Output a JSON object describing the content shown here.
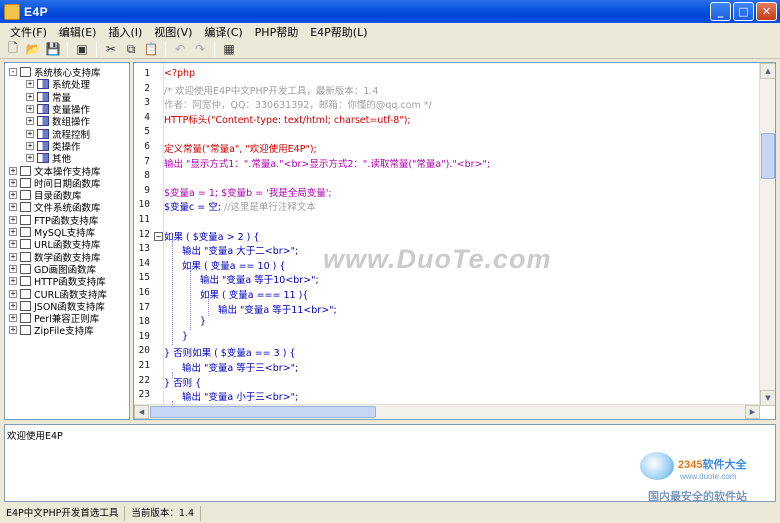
{
  "window": {
    "title": "E4P"
  },
  "menu": [
    "文件(F)",
    "编辑(E)",
    "插入(I)",
    "视图(V)",
    "编译(C)",
    "PHP帮助",
    "E4P帮助(L)"
  ],
  "toolbar": {
    "icons": [
      "new-file-icon",
      "open-folder-icon",
      "save-icon",
      "save-all-icon",
      "cut-icon",
      "copy-icon",
      "paste-icon",
      "undo-icon",
      "redo-icon",
      "compile-icon"
    ]
  },
  "tree": {
    "nodes": [
      {
        "label": "系统核心支持库",
        "level": 0,
        "expander": "-",
        "icon": "library"
      },
      {
        "label": "系统处理",
        "level": 1,
        "expander": "+",
        "icon": "book"
      },
      {
        "label": "常量",
        "level": 1,
        "expander": "+",
        "icon": "book"
      },
      {
        "label": "变量操作",
        "level": 1,
        "expander": "+",
        "icon": "book"
      },
      {
        "label": "数组操作",
        "level": 1,
        "expander": "+",
        "icon": "book"
      },
      {
        "label": "流程控制",
        "level": 1,
        "expander": "+",
        "icon": "book"
      },
      {
        "label": "类操作",
        "level": 1,
        "expander": "+",
        "icon": "book"
      },
      {
        "label": "其他",
        "level": 1,
        "expander": "+",
        "icon": "book"
      },
      {
        "label": "文本操作支持库",
        "level": 0,
        "expander": "+",
        "icon": "library"
      },
      {
        "label": "时间日期函数库",
        "level": 0,
        "expander": "+",
        "icon": "library"
      },
      {
        "label": "目录函数库",
        "level": 0,
        "expander": "+",
        "icon": "library"
      },
      {
        "label": "文件系统函数库",
        "level": 0,
        "expander": "+",
        "icon": "library"
      },
      {
        "label": "FTP函数支持库",
        "level": 0,
        "expander": "+",
        "icon": "library"
      },
      {
        "label": "MySQL支持库",
        "level": 0,
        "expander": "+",
        "icon": "library"
      },
      {
        "label": "URL函数支持库",
        "level": 0,
        "expander": "+",
        "icon": "library"
      },
      {
        "label": "数学函数支持库",
        "level": 0,
        "expander": "+",
        "icon": "library"
      },
      {
        "label": "GD画图函数库",
        "level": 0,
        "expander": "+",
        "icon": "library"
      },
      {
        "label": "HTTP函数支持库",
        "level": 0,
        "expander": "+",
        "icon": "library"
      },
      {
        "label": "CURL函数支持库",
        "level": 0,
        "expander": "+",
        "icon": "library"
      },
      {
        "label": "JSON函数支持库",
        "level": 0,
        "expander": "+",
        "icon": "library"
      },
      {
        "label": "Perl兼容正则库",
        "level": 0,
        "expander": "+",
        "icon": "library"
      },
      {
        "label": "ZipFile支持库",
        "level": 0,
        "expander": "+",
        "icon": "library"
      }
    ]
  },
  "editor": {
    "lines": [
      {
        "n": "1",
        "indent": 0,
        "parts": [
          {
            "t": "<?php",
            "c": "c-red"
          }
        ]
      },
      {
        "n": "2",
        "indent": 0,
        "parts": [
          {
            "t": "/* 欢迎使用E4P中文PHP开发工具，最新版本：1.4",
            "c": "c-gray"
          }
        ]
      },
      {
        "n": "3",
        "indent": 0,
        "parts": [
          {
            "t": "作者：阿宽仲，QQ：330631392，邮箱：你懂的@qq.com */",
            "c": "c-gray"
          }
        ]
      },
      {
        "n": "4",
        "indent": 0,
        "parts": [
          {
            "t": "HTTP标头(\"Content-type: text/html; charset=utf-8\");",
            "c": "c-red"
          }
        ]
      },
      {
        "n": "5",
        "indent": 0,
        "parts": []
      },
      {
        "n": "6",
        "indent": 0,
        "parts": [
          {
            "t": "定义常量(\"常量a\", \"欢迎使用E4P\");",
            "c": "c-red"
          }
        ]
      },
      {
        "n": "7",
        "indent": 0,
        "parts": [
          {
            "t": "输出 \"显示方式1：\".常量a.\"<br>显示方式2：\".读取常量(\"常量a\").\"<br>\";",
            "c": "c-purple"
          }
        ]
      },
      {
        "n": "8",
        "indent": 0,
        "parts": []
      },
      {
        "n": "9",
        "indent": 0,
        "parts": [
          {
            "t": "$变量a = 1; $变量b = '我是全局变量';",
            "c": "c-purple"
          }
        ]
      },
      {
        "n": "10",
        "indent": 0,
        "parts": [
          {
            "t": "$变量c = 空; ",
            "c": "c-blue"
          },
          {
            "t": "//这里是单行注释文本",
            "c": "c-gray"
          }
        ]
      },
      {
        "n": "11",
        "indent": 0,
        "parts": []
      },
      {
        "n": "12",
        "indent": 0,
        "parts": [
          {
            "t": "如果 ( $变量a > 2 ) {",
            "c": "c-blue"
          }
        ]
      },
      {
        "n": "13",
        "indent": 1,
        "parts": [
          {
            "t": "输出 \"变量a 大于二<br>\";",
            "c": "c-blue"
          }
        ]
      },
      {
        "n": "14",
        "indent": 1,
        "parts": [
          {
            "t": "如果 ( 变量a == 10 ) {",
            "c": "c-blue"
          }
        ]
      },
      {
        "n": "15",
        "indent": 2,
        "parts": [
          {
            "t": "输出 \"变量a 等于10<br>\";",
            "c": "c-blue"
          }
        ]
      },
      {
        "n": "16",
        "indent": 2,
        "parts": [
          {
            "t": "如果 ( 变量a === 11 ){",
            "c": "c-blue"
          }
        ]
      },
      {
        "n": "17",
        "indent": 3,
        "parts": [
          {
            "t": "输出 \"变量a 等于11<br>\";",
            "c": "c-blue"
          }
        ]
      },
      {
        "n": "18",
        "indent": 2,
        "parts": [
          {
            "t": "}",
            "c": "c-blue"
          }
        ]
      },
      {
        "n": "19",
        "indent": 1,
        "parts": [
          {
            "t": "}",
            "c": "c-blue"
          }
        ]
      },
      {
        "n": "20",
        "indent": 0,
        "parts": [
          {
            "t": "} 否则如果 ( $变量a == 3 ) {",
            "c": "c-blue"
          }
        ]
      },
      {
        "n": "21",
        "indent": 1,
        "parts": [
          {
            "t": "输出 \"变量a 等于三<br>\";",
            "c": "c-blue"
          }
        ]
      },
      {
        "n": "22",
        "indent": 0,
        "parts": [
          {
            "t": "} 否则 {",
            "c": "c-blue"
          }
        ]
      },
      {
        "n": "23",
        "indent": 1,
        "parts": [
          {
            "t": "输出 \"变量a 小于三<br>\";",
            "c": "c-blue"
          }
        ]
      }
    ]
  },
  "output": {
    "text": "欢迎使用E4P"
  },
  "status": {
    "left": "E4P中文PHP开发首选工具",
    "version": "当前版本：1.4"
  },
  "watermark": {
    "text": "www.DuoTe.com"
  },
  "brand_logo": {
    "name": "2345",
    "suffix": "软件大全",
    "url": "www.duote.com",
    "slogan": "国内最安全的软件站"
  }
}
